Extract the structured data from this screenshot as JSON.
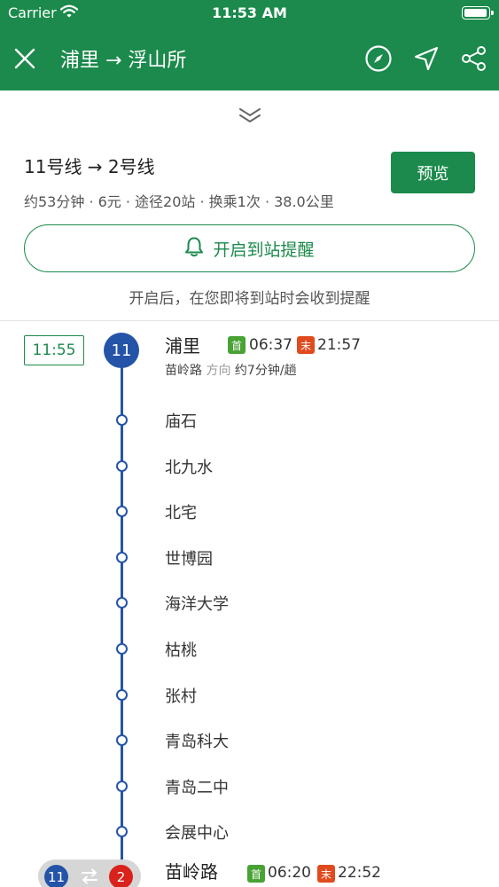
{
  "status_bar": {
    "carrier": "Carrier",
    "time": "11:53 AM",
    "battery_level": 1.0
  },
  "nav": {
    "title": "浦里 → 浮山所",
    "icons": [
      "close-icon",
      "compass-icon",
      "navigate-icon",
      "share-icon"
    ]
  },
  "route": {
    "title": "11号线 → 2号线",
    "meta": "约53分钟 · 6元 · 途径20站 · 换乘1次 · 38.0公里",
    "preview_label": "预览"
  },
  "reminder": {
    "label": "开启到站提醒",
    "hint": "开启后，在您即将到站时会收到提醒"
  },
  "start": {
    "depart_time": "11:55",
    "line_number": "11",
    "station": "浦里",
    "first_label": "首",
    "first_time": "06:37",
    "last_label": "末",
    "last_time": "21:57",
    "direction_station": "苗岭路",
    "direction_label": "方向",
    "interval": "约7分钟/趟"
  },
  "stops": [
    "庙石",
    "北九水",
    "北宅",
    "世博园",
    "海洋大学",
    "枯桃",
    "张村",
    "青岛科大",
    "青岛二中",
    "会展中心"
  ],
  "transfer": {
    "from_line": "11",
    "to_line": "2",
    "station": "苗岭路",
    "first_label": "首",
    "first_time": "06:20",
    "last_label": "末",
    "last_time": "22:52"
  },
  "colors": {
    "brand_green": "#1b8a4c",
    "line_11": "#2454a8",
    "line_2": "#d9221c",
    "first_badge": "#48a234",
    "last_badge": "#e04b1e"
  }
}
